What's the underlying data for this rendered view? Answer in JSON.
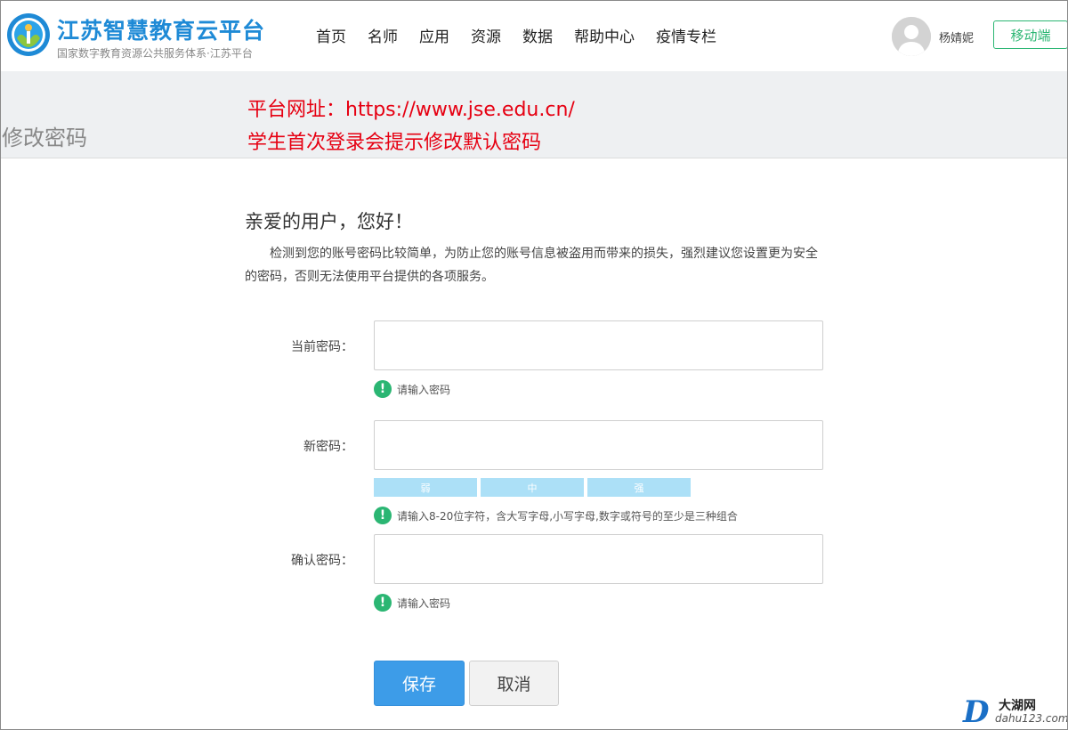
{
  "header": {
    "logo_title": "江苏智慧教育云平台",
    "logo_subtitle": "国家数字教育资源公共服务体系·江苏平台",
    "nav": [
      "首页",
      "名师",
      "应用",
      "资源",
      "数据",
      "帮助中心",
      "疫情专栏"
    ],
    "username": "杨婧妮",
    "mobile_label": "移动端"
  },
  "banner": {
    "title": "修改密码",
    "note_line1": "平台网址：https://www.jse.edu.cn/",
    "note_line2": "学生首次登录会提示修改默认密码"
  },
  "main": {
    "greeting": "亲爱的用户，您好！",
    "description": "检测到您的账号密码比较简单，为防止您的账号信息被盗用而带来的损失，强烈建议您设置更为安全的密码，否则无法使用平台提供的各项服务。",
    "current_password": {
      "label": "当前密码：",
      "value": "",
      "hint": "请输入密码"
    },
    "new_password": {
      "label": "新密码：",
      "value": "",
      "hint": "请输入8-20位字符，含大写字母,小写字母,数字或符号的至少是三种组合"
    },
    "confirm_password": {
      "label": "确认密码：",
      "value": "",
      "hint": "请输入密码"
    },
    "strength": [
      "弱",
      "中",
      "强"
    ],
    "hint_symbol": "!",
    "save_label": "保存",
    "cancel_label": "取消"
  },
  "watermark": {
    "letter": "D",
    "name": "大湖网",
    "url": "dahu123.com"
  },
  "colors": {
    "brand": "#1e8ad6",
    "accent_green": "#2bb673",
    "note_red": "#e60012",
    "primary_button": "#3d9ce8"
  },
  "icons": {
    "logo": "jiangsu-edu-cloud-logo-icon",
    "avatar": "user-avatar-icon",
    "hint": "exclamation-circle-icon"
  }
}
